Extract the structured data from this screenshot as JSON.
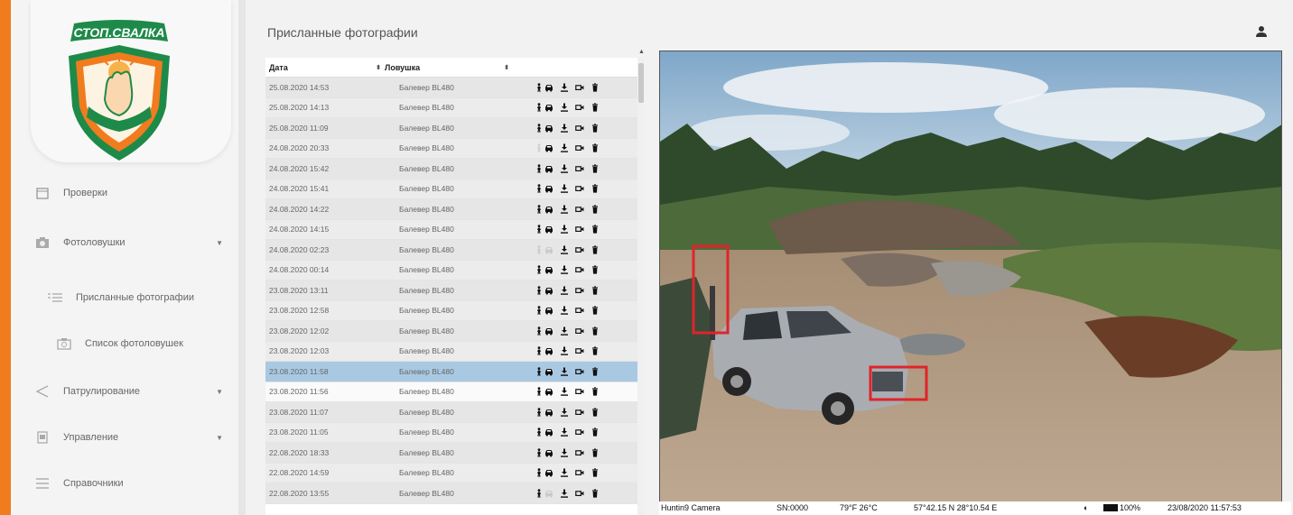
{
  "brand": {
    "logo_text": "СТОП.СВАЛКА",
    "accent": "#f07c1e",
    "logo_green": "#1e8a4a",
    "logo_orange": "#f07c1e"
  },
  "sidebar": {
    "items": [
      {
        "label": "Проверки",
        "icon": "calendar-icon",
        "expandable": false
      },
      {
        "label": "Фотоловушки",
        "icon": "camera-icon",
        "expandable": true
      },
      {
        "label": "Присланные фотографии",
        "icon": "list-icon",
        "expandable": false
      },
      {
        "label": "Список фотоловушек",
        "icon": "camera-icon",
        "expandable": false
      },
      {
        "label": "Патрулирование",
        "icon": "share-icon",
        "expandable": true
      },
      {
        "label": "Управление",
        "icon": "document-icon",
        "expandable": true
      },
      {
        "label": "Справочники",
        "icon": "menu-icon",
        "expandable": false
      }
    ]
  },
  "header": {
    "title": "Присланные фотографии",
    "user_icon": "user-icon"
  },
  "table": {
    "columns": [
      "Дата",
      "Ловушка"
    ],
    "rows": [
      {
        "date": "25.08.2020 14:53",
        "trap": "Балевер BL480",
        "person": true,
        "car": true
      },
      {
        "date": "25.08.2020 14:13",
        "trap": "Балевер BL480",
        "person": true,
        "car": true
      },
      {
        "date": "25.08.2020 11:09",
        "trap": "Балевер BL480",
        "person": true,
        "car": true
      },
      {
        "date": "24.08.2020 20:33",
        "trap": "Балевер BL480",
        "person": false,
        "car": true
      },
      {
        "date": "24.08.2020 15:42",
        "trap": "Балевер BL480",
        "person": true,
        "car": true
      },
      {
        "date": "24.08.2020 15:41",
        "trap": "Балевер BL480",
        "person": true,
        "car": true
      },
      {
        "date": "24.08.2020 14:22",
        "trap": "Балевер BL480",
        "person": true,
        "car": true
      },
      {
        "date": "24.08.2020 14:15",
        "trap": "Балевер BL480",
        "person": true,
        "car": true
      },
      {
        "date": "24.08.2020 02:23",
        "trap": "Балевер BL480",
        "person": false,
        "car": false
      },
      {
        "date": "24.08.2020 00:14",
        "trap": "Балевер BL480",
        "person": true,
        "car": true
      },
      {
        "date": "23.08.2020 13:11",
        "trap": "Балевер BL480",
        "person": true,
        "car": true
      },
      {
        "date": "23.08.2020 12:58",
        "trap": "Балевер BL480",
        "person": true,
        "car": true
      },
      {
        "date": "23.08.2020 12:02",
        "trap": "Балевер BL480",
        "person": true,
        "car": true
      },
      {
        "date": "23.08.2020 12:03",
        "trap": "Балевер BL480",
        "person": true,
        "car": true
      },
      {
        "date": "23.08.2020 11:58",
        "trap": "Балевер BL480",
        "person": true,
        "car": true,
        "selected": true
      },
      {
        "date": "23.08.2020 11:56",
        "trap": "Балевер BL480",
        "person": true,
        "car": true
      },
      {
        "date": "23.08.2020 11:07",
        "trap": "Балевер BL480",
        "person": true,
        "car": true
      },
      {
        "date": "23.08.2020 11:05",
        "trap": "Балевер BL480",
        "person": true,
        "car": true
      },
      {
        "date": "22.08.2020 18:33",
        "trap": "Балевер BL480",
        "person": true,
        "car": true
      },
      {
        "date": "22.08.2020 14:59",
        "trap": "Балевер BL480",
        "person": true,
        "car": true
      },
      {
        "date": "22.08.2020 13:55",
        "trap": "Балевер BL480",
        "person": true,
        "car": false
      }
    ]
  },
  "photo": {
    "caption": {
      "camera": "Huntin9 Camera",
      "serial": "SN:0000",
      "temperature": "79°F  26°C",
      "coordinates": "57°42.15 N  28°10.54 E",
      "battery": "100%",
      "timestamp": "23/08/2020 11:57:53"
    },
    "detections_color": "#e0242a"
  }
}
